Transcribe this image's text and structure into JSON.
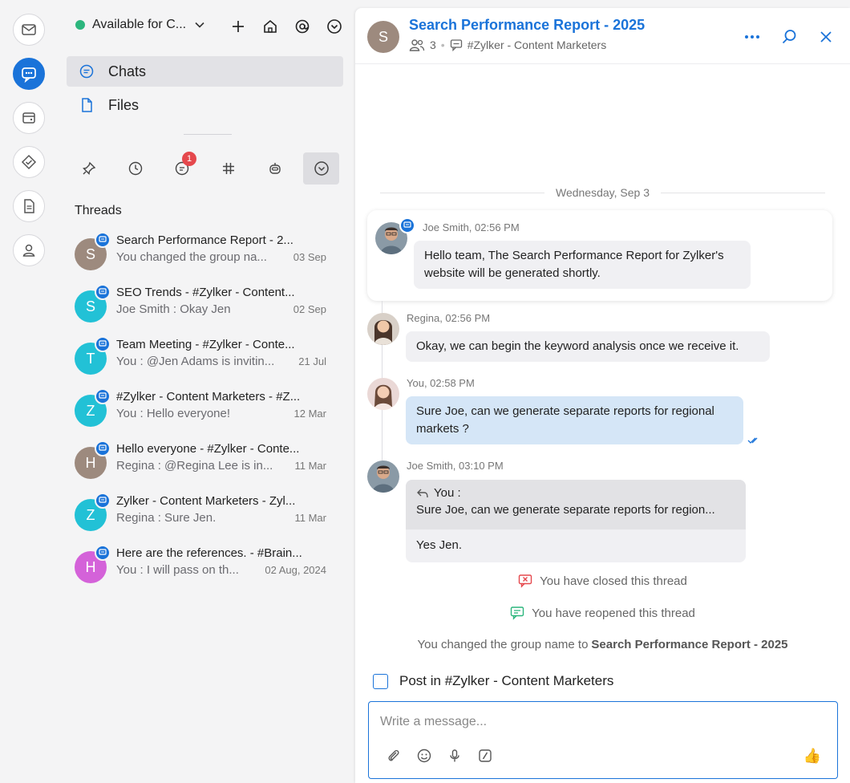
{
  "status": {
    "label": "Available for C..."
  },
  "nav": [
    {
      "label": "Chats"
    },
    {
      "label": "Files"
    }
  ],
  "filters": {
    "mentions_badge": "1"
  },
  "threads_section": {
    "title": "Threads"
  },
  "threads": [
    {
      "initial": "S",
      "color": "#9d8a7e",
      "title": "Search Performance Report - 2...",
      "subtitle": "You changed the group na...",
      "date": "03 Sep"
    },
    {
      "initial": "S",
      "color": "#22c1d6",
      "title": "SEO Trends - #Zylker - Content...",
      "subtitle": "Joe Smith : Okay Jen",
      "date": "02 Sep"
    },
    {
      "initial": "T",
      "color": "#22c1d6",
      "title": "Team Meeting - #Zylker - Conte...",
      "subtitle": "You : @Jen Adams  is invitin...",
      "date": "21 Jul"
    },
    {
      "initial": "Z",
      "color": "#22c1d6",
      "title": "#Zylker - Content Marketers - #Z...",
      "subtitle": "You : Hello everyone!",
      "date": "12 Mar"
    },
    {
      "initial": "H",
      "color": "#9d8a7e",
      "title": "Hello everyone - #Zylker - Conte...",
      "subtitle": "Regina : @Regina Lee  is in...",
      "date": "11 Mar"
    },
    {
      "initial": "Z",
      "color": "#22c1d6",
      "title": "Zylker - Content Marketers - Zyl...",
      "subtitle": "Regina : Sure Jen.",
      "date": "11 Mar"
    },
    {
      "initial": "H",
      "color": "#d462d9",
      "title": "Here are the references. - #Brain...",
      "subtitle": "You : I will pass on th...",
      "date": "02 Aug, 2024"
    }
  ],
  "chat": {
    "avatar_initial": "S",
    "title": "Search Performance Report - 2025",
    "member_count": "3",
    "channel": "#Zylker - Content Marketers",
    "day_separator": "Wednesday, Sep 3",
    "messages": [
      {
        "author": "Joe Smith, 02:56 PM",
        "text": "Hello team, The Search Performance Report for Zylker's website will be generated shortly."
      },
      {
        "author": "Regina, 02:56 PM",
        "text": "Okay, we can begin the keyword analysis once we receive it."
      },
      {
        "author": "You, 02:58 PM",
        "text": "Sure Joe, can we generate separate reports for regional markets ?"
      },
      {
        "author": "Joe Smith, 03:10 PM",
        "quote_author": "You :",
        "quote_text": "Sure Joe, can we generate separate reports for region...",
        "text": "Yes Jen."
      }
    ],
    "system": {
      "closed": "You have closed this thread",
      "reopened": "You have reopened this thread",
      "renamed_prefix": "You changed the group name to",
      "renamed_value": "Search Performance Report - 2025"
    },
    "post_in_label": "Post in #Zylker - Content Marketers",
    "composer_placeholder": "Write a message..."
  },
  "colors": {
    "accent": "#1a73d9",
    "online": "#2cb67d",
    "badge": "#e5484d"
  }
}
